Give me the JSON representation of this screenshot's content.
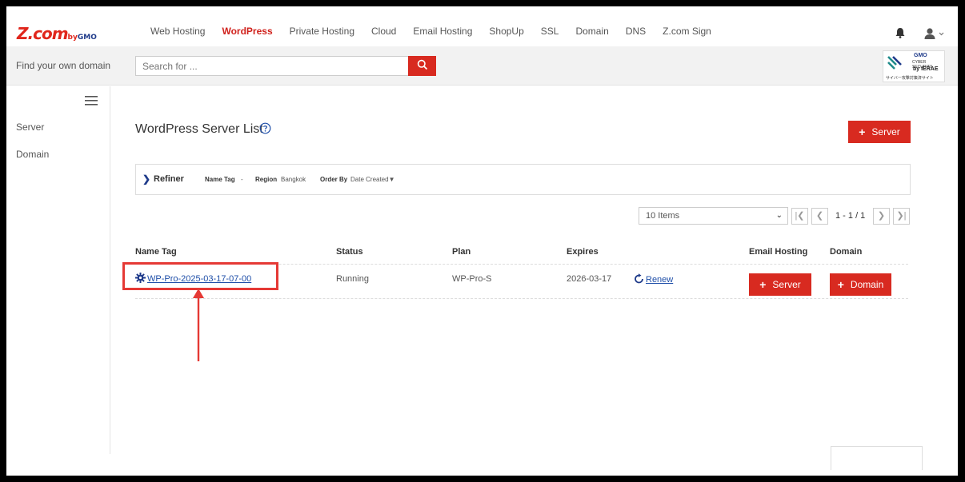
{
  "brand": {
    "name": "Z.com",
    "suffix_by": "by",
    "suffix_gmo": "GMO"
  },
  "nav": {
    "items": [
      {
        "label": "Web Hosting",
        "active": false
      },
      {
        "label": "WordPress",
        "active": true
      },
      {
        "label": "Private Hosting",
        "active": false
      },
      {
        "label": "Cloud",
        "active": false
      },
      {
        "label": "Email Hosting",
        "active": false
      },
      {
        "label": "ShopUp",
        "active": false
      },
      {
        "label": "SSL",
        "active": false
      },
      {
        "label": "Domain",
        "active": false
      },
      {
        "label": "DNS",
        "active": false
      },
      {
        "label": "Z.com Sign",
        "active": false
      }
    ],
    "icons": [
      "bell-icon",
      "user-icon"
    ]
  },
  "search": {
    "label": "Find your own domain",
    "placeholder": "Search for ...",
    "button_icon": "search-icon"
  },
  "security_badge": {
    "brand": "GMO",
    "line1": "CYBER SECURITY",
    "line2": "by IERAE",
    "line3": "サイバー攻撃対策済サイト"
  },
  "sidebar": {
    "items": [
      {
        "label": "Server"
      },
      {
        "label": "Domain"
      }
    ]
  },
  "main": {
    "title": "WordPress Server List",
    "add_server_label": "Server"
  },
  "refiner": {
    "title": "Refiner",
    "name_tag_label": "Name Tag",
    "name_tag_value": "-",
    "region_label": "Region",
    "region_value": "Bangkok",
    "order_by_label": "Order By",
    "order_by_value": "Date Created▼"
  },
  "pagination": {
    "items_per_page": "10 Items",
    "page_info": "1 - 1 / 1"
  },
  "table": {
    "headers": {
      "name_tag": "Name Tag",
      "status": "Status",
      "plan": "Plan",
      "expires": "Expires",
      "email_hosting": "Email Hosting",
      "domain": "Domain"
    },
    "rows": [
      {
        "name_tag": "WP-Pro-2025-03-17-07-00",
        "status": "Running",
        "plan": "WP-Pro-S",
        "expires": "2026-03-17",
        "renew": "Renew",
        "email_button": "Server",
        "domain_button": "Domain"
      }
    ]
  },
  "colors": {
    "brand_red": "#d82a20",
    "link_blue": "#1e4ea8",
    "annotation_red": "#e53935"
  }
}
